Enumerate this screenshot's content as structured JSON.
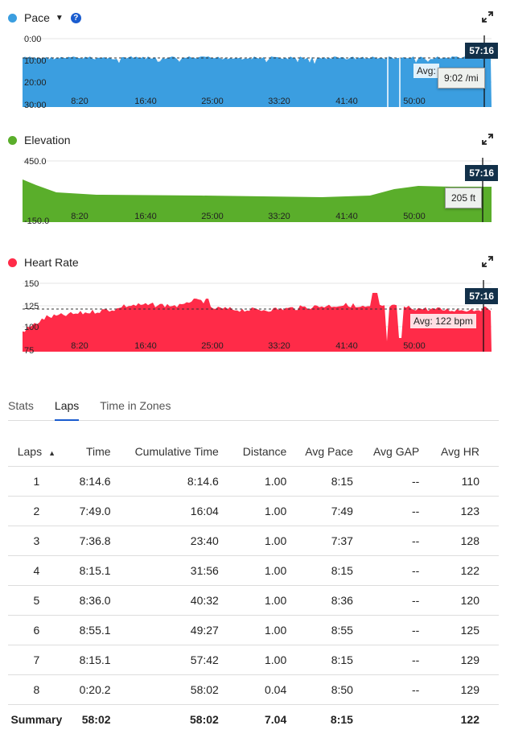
{
  "charts": {
    "pace": {
      "title": "Pace",
      "color": "#3b9ee0",
      "yticks": [
        "0:00",
        "10:00",
        "20:00",
        "30:00"
      ],
      "xticks": [
        "8:20",
        "16:40",
        "25:00",
        "33:20",
        "41:40",
        "50:00"
      ],
      "time": "57:16",
      "avg_label": "Avg:",
      "tooltip": "9:02 /mi"
    },
    "elevation": {
      "title": "Elevation",
      "color": "#5aae2b",
      "yticks": [
        "450.0",
        "-150.0"
      ],
      "xticks": [
        "8:20",
        "16:40",
        "25:00",
        "33:20",
        "41:40",
        "50:00"
      ],
      "time": "57:16",
      "tooltip": "205 ft"
    },
    "heart_rate": {
      "title": "Heart Rate",
      "color": "#ff2b48",
      "yticks": [
        "150",
        "125",
        "100",
        "75"
      ],
      "xticks": [
        "8:20",
        "16:40",
        "25:00",
        "33:20",
        "41:40",
        "50:00"
      ],
      "time": "57:16",
      "avg_label": "Avg: 122 bpm"
    }
  },
  "tabs": [
    "Stats",
    "Laps",
    "Time in Zones"
  ],
  "table": {
    "headers": [
      "Laps",
      "Time",
      "Cumulative Time",
      "Distance",
      "Avg Pace",
      "Avg GAP",
      "Avg HR"
    ],
    "rows": [
      [
        "1",
        "8:14.6",
        "8:14.6",
        "1.00",
        "8:15",
        "--",
        "110"
      ],
      [
        "2",
        "7:49.0",
        "16:04",
        "1.00",
        "7:49",
        "--",
        "123"
      ],
      [
        "3",
        "7:36.8",
        "23:40",
        "1.00",
        "7:37",
        "--",
        "128"
      ],
      [
        "4",
        "8:15.1",
        "31:56",
        "1.00",
        "8:15",
        "--",
        "122"
      ],
      [
        "5",
        "8:36.0",
        "40:32",
        "1.00",
        "8:36",
        "--",
        "120"
      ],
      [
        "6",
        "8:55.1",
        "49:27",
        "1.00",
        "8:55",
        "--",
        "125"
      ],
      [
        "7",
        "8:15.1",
        "57:42",
        "1.00",
        "8:15",
        "--",
        "129"
      ],
      [
        "8",
        "0:20.2",
        "58:02",
        "0.04",
        "8:50",
        "--",
        "129"
      ]
    ],
    "summary": [
      "Summary",
      "58:02",
      "58:02",
      "7.04",
      "8:15",
      "",
      "122"
    ]
  }
}
